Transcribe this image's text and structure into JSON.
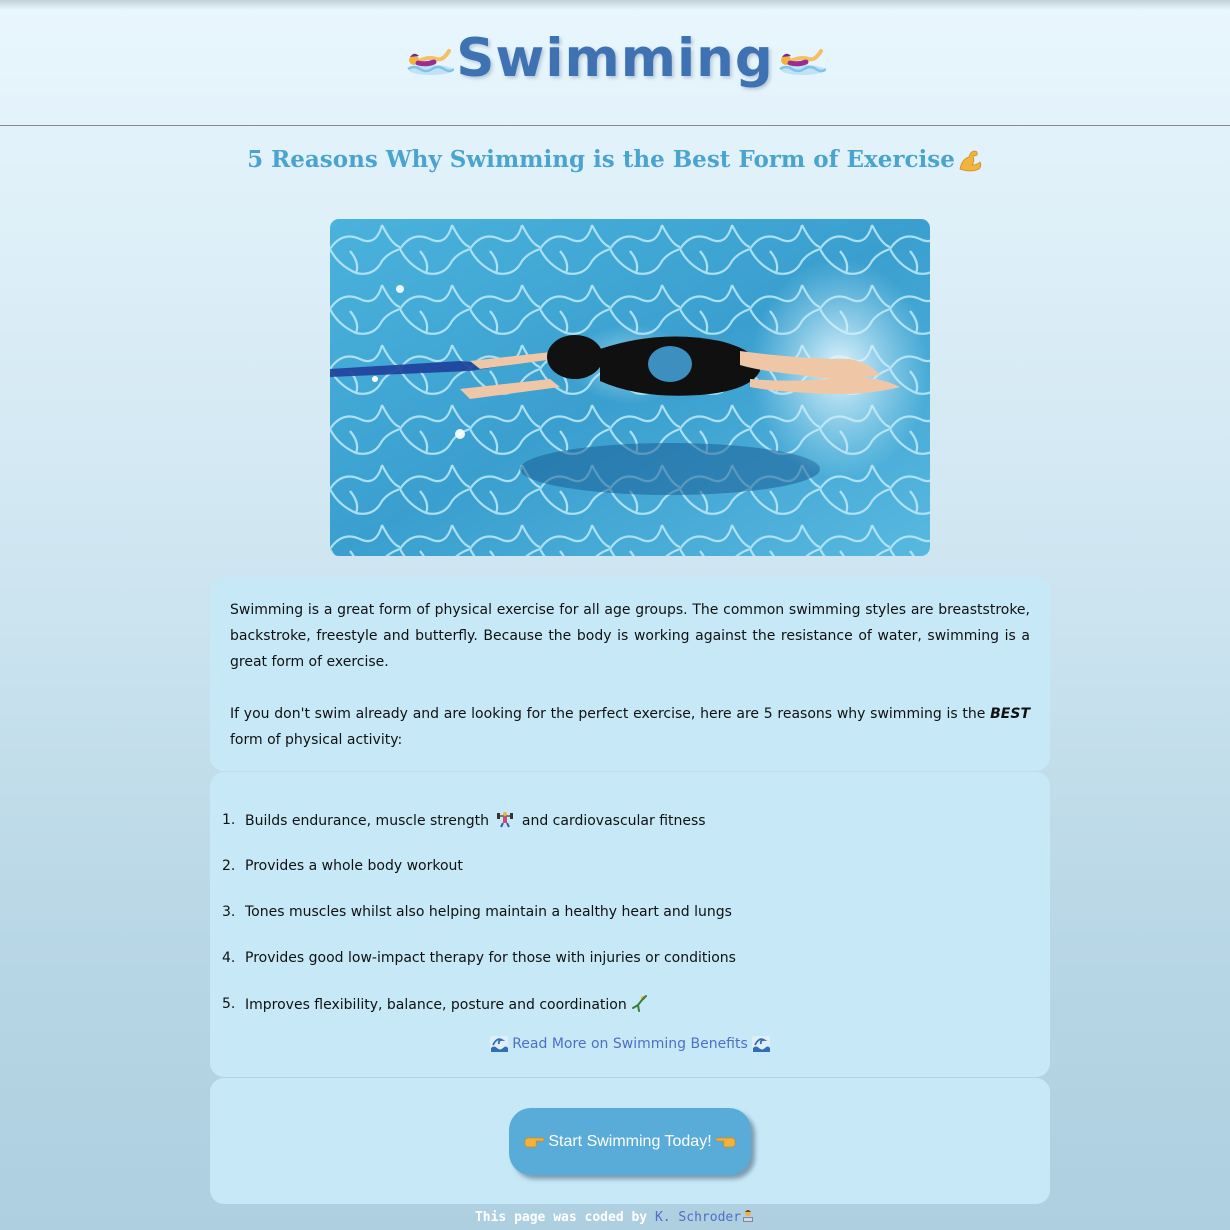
{
  "header": {
    "title": "Swimming",
    "icon_left": "woman-swimming-icon",
    "icon_right": "woman-swimming-icon"
  },
  "article": {
    "heading": "5 Reasons Why Swimming is the Best Form of Exercise",
    "heading_icon": "flexed-biceps-icon",
    "hero_image": "swimmer-in-pool-image",
    "intro_paragraph_1": "Swimming is a great form of physical exercise for all age groups. The common swimming styles are breaststroke, backstroke, freestyle and butterfly. Because the body is working against the resistance of water, swimming is a great form of exercise.",
    "intro_paragraph_2_before": "If you don't swim already and are looking for the perfect exercise, here are 5 reasons why swimming is the ",
    "intro_paragraph_2_emphasis": "BEST",
    "intro_paragraph_2_after": " form of physical activity:"
  },
  "reasons": [
    {
      "num": "1.",
      "before": "Builds endurance, muscle strength ",
      "icon": "weightlifter-icon",
      "after": " and cardiovascular fitness"
    },
    {
      "num": "2.",
      "text": "Provides a whole body workout"
    },
    {
      "num": "3.",
      "text": "Tones muscles whilst also helping maintain a healthy heart and lungs"
    },
    {
      "num": "4.",
      "text": "Provides good low-impact therapy for those with injuries or conditions"
    },
    {
      "num": "5.",
      "before": "Improves flexibility, balance, posture and coordination",
      "icon": "gymnast-icon",
      "after": ""
    }
  ],
  "read_more": {
    "label": "Read More on Swimming Benefits",
    "icon": "water-wave-icon"
  },
  "cta": {
    "label": "Start Swimming Today!",
    "icon_left": "pointing-right-icon",
    "icon_right": "pointing-left-icon"
  },
  "footer": {
    "prefix": "This page was coded by ",
    "author": "K. Schroder",
    "author_icon": "technologist-icon"
  },
  "colors": {
    "title": "#3f72b3",
    "subtitle": "#4aa4cf",
    "card": "#c7e9f7",
    "button": "#59acd8",
    "link": "#4f6fc6"
  }
}
